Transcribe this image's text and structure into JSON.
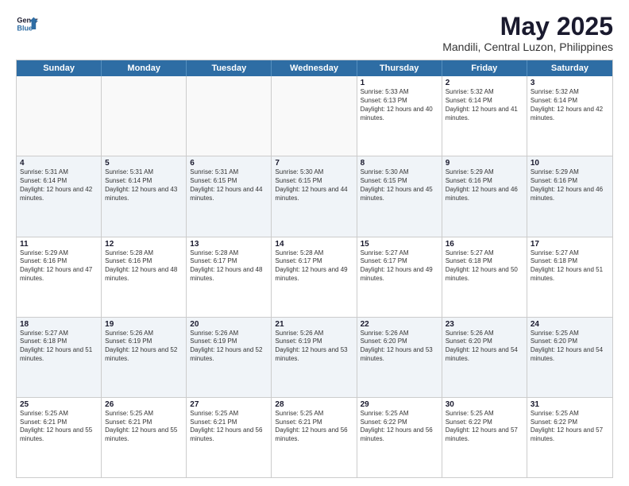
{
  "header": {
    "logo_line1": "General",
    "logo_line2": "Blue",
    "title": "May 2025",
    "subtitle": "Mandili, Central Luzon, Philippines"
  },
  "days_of_week": [
    "Sunday",
    "Monday",
    "Tuesday",
    "Wednesday",
    "Thursday",
    "Friday",
    "Saturday"
  ],
  "weeks": [
    [
      {
        "day": "",
        "empty": true
      },
      {
        "day": "",
        "empty": true
      },
      {
        "day": "",
        "empty": true
      },
      {
        "day": "",
        "empty": true
      },
      {
        "day": "1",
        "sunrise": "5:33 AM",
        "sunset": "6:13 PM",
        "daylight": "12 hours and 40 minutes."
      },
      {
        "day": "2",
        "sunrise": "5:32 AM",
        "sunset": "6:14 PM",
        "daylight": "12 hours and 41 minutes."
      },
      {
        "day": "3",
        "sunrise": "5:32 AM",
        "sunset": "6:14 PM",
        "daylight": "12 hours and 42 minutes."
      }
    ],
    [
      {
        "day": "4",
        "sunrise": "5:31 AM",
        "sunset": "6:14 PM",
        "daylight": "12 hours and 42 minutes."
      },
      {
        "day": "5",
        "sunrise": "5:31 AM",
        "sunset": "6:14 PM",
        "daylight": "12 hours and 43 minutes."
      },
      {
        "day": "6",
        "sunrise": "5:31 AM",
        "sunset": "6:15 PM",
        "daylight": "12 hours and 44 minutes."
      },
      {
        "day": "7",
        "sunrise": "5:30 AM",
        "sunset": "6:15 PM",
        "daylight": "12 hours and 44 minutes."
      },
      {
        "day": "8",
        "sunrise": "5:30 AM",
        "sunset": "6:15 PM",
        "daylight": "12 hours and 45 minutes."
      },
      {
        "day": "9",
        "sunrise": "5:29 AM",
        "sunset": "6:16 PM",
        "daylight": "12 hours and 46 minutes."
      },
      {
        "day": "10",
        "sunrise": "5:29 AM",
        "sunset": "6:16 PM",
        "daylight": "12 hours and 46 minutes."
      }
    ],
    [
      {
        "day": "11",
        "sunrise": "5:29 AM",
        "sunset": "6:16 PM",
        "daylight": "12 hours and 47 minutes."
      },
      {
        "day": "12",
        "sunrise": "5:28 AM",
        "sunset": "6:16 PM",
        "daylight": "12 hours and 48 minutes."
      },
      {
        "day": "13",
        "sunrise": "5:28 AM",
        "sunset": "6:17 PM",
        "daylight": "12 hours and 48 minutes."
      },
      {
        "day": "14",
        "sunrise": "5:28 AM",
        "sunset": "6:17 PM",
        "daylight": "12 hours and 49 minutes."
      },
      {
        "day": "15",
        "sunrise": "5:27 AM",
        "sunset": "6:17 PM",
        "daylight": "12 hours and 49 minutes."
      },
      {
        "day": "16",
        "sunrise": "5:27 AM",
        "sunset": "6:18 PM",
        "daylight": "12 hours and 50 minutes."
      },
      {
        "day": "17",
        "sunrise": "5:27 AM",
        "sunset": "6:18 PM",
        "daylight": "12 hours and 51 minutes."
      }
    ],
    [
      {
        "day": "18",
        "sunrise": "5:27 AM",
        "sunset": "6:18 PM",
        "daylight": "12 hours and 51 minutes."
      },
      {
        "day": "19",
        "sunrise": "5:26 AM",
        "sunset": "6:19 PM",
        "daylight": "12 hours and 52 minutes."
      },
      {
        "day": "20",
        "sunrise": "5:26 AM",
        "sunset": "6:19 PM",
        "daylight": "12 hours and 52 minutes."
      },
      {
        "day": "21",
        "sunrise": "5:26 AM",
        "sunset": "6:19 PM",
        "daylight": "12 hours and 53 minutes."
      },
      {
        "day": "22",
        "sunrise": "5:26 AM",
        "sunset": "6:20 PM",
        "daylight": "12 hours and 53 minutes."
      },
      {
        "day": "23",
        "sunrise": "5:26 AM",
        "sunset": "6:20 PM",
        "daylight": "12 hours and 54 minutes."
      },
      {
        "day": "24",
        "sunrise": "5:25 AM",
        "sunset": "6:20 PM",
        "daylight": "12 hours and 54 minutes."
      }
    ],
    [
      {
        "day": "25",
        "sunrise": "5:25 AM",
        "sunset": "6:21 PM",
        "daylight": "12 hours and 55 minutes."
      },
      {
        "day": "26",
        "sunrise": "5:25 AM",
        "sunset": "6:21 PM",
        "daylight": "12 hours and 55 minutes."
      },
      {
        "day": "27",
        "sunrise": "5:25 AM",
        "sunset": "6:21 PM",
        "daylight": "12 hours and 56 minutes."
      },
      {
        "day": "28",
        "sunrise": "5:25 AM",
        "sunset": "6:21 PM",
        "daylight": "12 hours and 56 minutes."
      },
      {
        "day": "29",
        "sunrise": "5:25 AM",
        "sunset": "6:22 PM",
        "daylight": "12 hours and 56 minutes."
      },
      {
        "day": "30",
        "sunrise": "5:25 AM",
        "sunset": "6:22 PM",
        "daylight": "12 hours and 57 minutes."
      },
      {
        "day": "31",
        "sunrise": "5:25 AM",
        "sunset": "6:22 PM",
        "daylight": "12 hours and 57 minutes."
      }
    ]
  ]
}
